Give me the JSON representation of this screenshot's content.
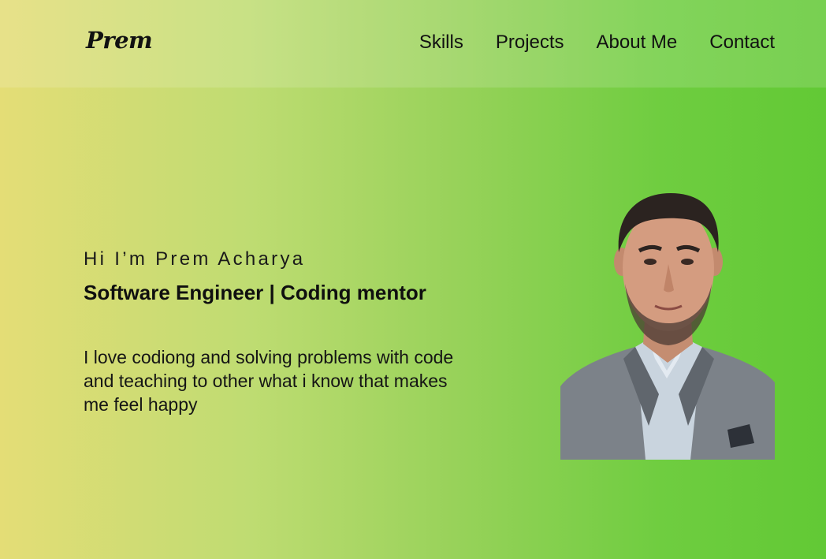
{
  "brand": {
    "logo_text": "Prem"
  },
  "nav": {
    "items": [
      {
        "label": "Skills"
      },
      {
        "label": "Projects"
      },
      {
        "label": "About Me"
      },
      {
        "label": "Contact"
      }
    ]
  },
  "hero": {
    "greeting": "Hi I’m Prem Acharya",
    "role": "Software Engineer | Coding mentor",
    "bio": "I love codiong and solving problems with code and teaching to other what i know that makes me feel happy"
  },
  "colors": {
    "gradient_left": "#e4dd76",
    "gradient_right": "#62c935",
    "text": "#0c0c0c"
  }
}
